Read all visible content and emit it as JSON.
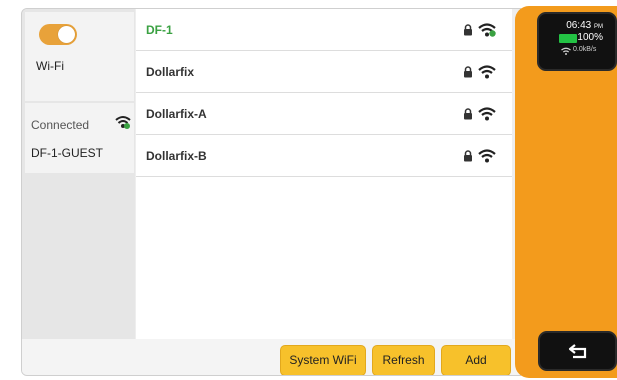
{
  "wifi_toggle": {
    "label": "Wi-Fi",
    "on": true
  },
  "connection": {
    "status_label": "Connected",
    "network_name": "DF-1-GUEST"
  },
  "networks": [
    {
      "name": "DF-1",
      "connected": true
    },
    {
      "name": "Dollarfix",
      "connected": false
    },
    {
      "name": "Dollarfix-A",
      "connected": false
    },
    {
      "name": "Dollarfix-B",
      "connected": false
    }
  ],
  "buttons": {
    "system_wifi": "System WiFi",
    "refresh": "Refresh",
    "add": "Add"
  },
  "status": {
    "time": "06:43",
    "ampm": "PM",
    "battery": "100%",
    "rate": "0.0kB/s"
  },
  "colors": {
    "accent": "#f39b1c",
    "button": "#f7c12b",
    "connected_text": "#3aa142",
    "battery": "#23c244"
  },
  "icons": {
    "lock": "lock-icon",
    "signal": "wifi-signal-icon",
    "back": "back-arrow-icon"
  }
}
